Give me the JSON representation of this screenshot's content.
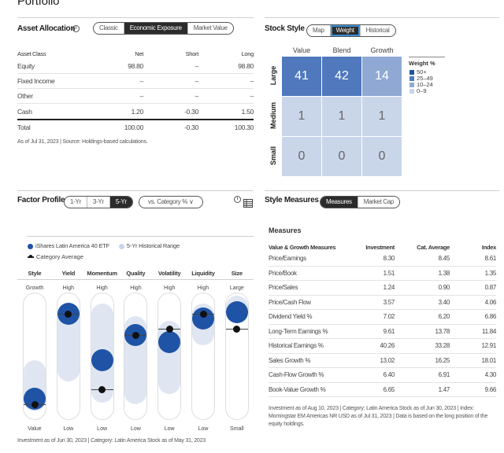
{
  "page_title": "Portfolio",
  "asset_allocation": {
    "title": "Asset Allocation",
    "tabs": [
      {
        "label": "Classic",
        "active": false
      },
      {
        "label": "Economic Exposure",
        "active": true
      },
      {
        "label": "Market Value",
        "active": false
      }
    ],
    "columns": [
      "Asset Class",
      "Net",
      "Short",
      "Long"
    ],
    "rows": [
      {
        "name": "Equity",
        "net": "98.80",
        "short": "–",
        "long": "98.80"
      },
      {
        "name": "Fixed Income",
        "net": "–",
        "short": "–",
        "long": "–"
      },
      {
        "name": "Other",
        "net": "–",
        "short": "–",
        "long": "–"
      },
      {
        "name": "Cash",
        "net": "1.20",
        "short": "-0.30",
        "long": "1.50"
      }
    ],
    "total": {
      "name": "Total",
      "net": "100.00",
      "short": "-0.30",
      "long": "100.30"
    },
    "note": "As of Jul 31, 2023 | Source: Holdings-based calculations."
  },
  "stock_style": {
    "title": "Stock Style",
    "tabs": [
      {
        "label": "Map",
        "active": false
      },
      {
        "label": "Weight",
        "active": true
      },
      {
        "label": "Historical",
        "active": false
      }
    ],
    "columns": [
      "Value",
      "Blend",
      "Growth"
    ],
    "rows": [
      "Large",
      "Medium",
      "Small"
    ],
    "values": [
      [
        "41",
        "42",
        "14"
      ],
      [
        "1",
        "1",
        "1"
      ],
      [
        "0",
        "0",
        "0"
      ]
    ],
    "legend_title": "Weight %",
    "legend": [
      {
        "label": "50+",
        "color": "#1f53a5"
      },
      {
        "label": "25–49",
        "color": "#4f78bd"
      },
      {
        "label": "10–24",
        "color": "#8fa9d4"
      },
      {
        "label": "0–9",
        "color": "#c9d6ea"
      }
    ]
  },
  "factor_profile": {
    "title": "Factor Profile",
    "period_tabs": [
      {
        "label": "1-Yr",
        "active": false
      },
      {
        "label": "3-Yr",
        "active": false
      },
      {
        "label": "5-Yr",
        "active": true
      }
    ],
    "compare_select": "vs. Category % ∨",
    "legend": {
      "fund": "iShares Latin America 40 ETF",
      "range": "5-Yr Historical Range",
      "category": "Category Average"
    },
    "factors": [
      {
        "name": "Style",
        "top": "Growth",
        "bottom": "Value",
        "fund": 0.16,
        "category": 0.12,
        "range": [
          0.06,
          0.47
        ]
      },
      {
        "name": "Yield",
        "top": "High",
        "bottom": "Low",
        "fund": 0.84,
        "category": 0.84,
        "range": [
          0.3,
          0.91
        ]
      },
      {
        "name": "Momentum",
        "top": "High",
        "bottom": "Low",
        "fund": 0.47,
        "category": 0.24,
        "range": [
          0.13,
          0.92
        ]
      },
      {
        "name": "Quality",
        "top": "High",
        "bottom": "Low",
        "fund": 0.67,
        "category": 0.67,
        "range": [
          0.12,
          0.82
        ]
      },
      {
        "name": "Volatility",
        "top": "High",
        "bottom": "Low",
        "fund": 0.61,
        "category": 0.72,
        "range": [
          0.2,
          0.78
        ]
      },
      {
        "name": "Liquidity",
        "top": "High",
        "bottom": "Low",
        "fund": 0.8,
        "category": 0.84,
        "range": [
          0.59,
          0.92
        ]
      },
      {
        "name": "Size",
        "top": "Large",
        "bottom": "Small",
        "fund": 0.85,
        "category": 0.72,
        "range": [
          0.76,
          0.98
        ]
      }
    ],
    "note": "Investment as of Jun 30, 2023 | Category: Latin America Stock as of May 31, 2023"
  },
  "style_measures": {
    "title": "Style Measures",
    "tabs": [
      {
        "label": "Measures",
        "active": true
      },
      {
        "label": "Market Cap",
        "active": false
      }
    ],
    "subtitle": "Measures",
    "columns": [
      "Value & Growth Measures",
      "Investment",
      "Cat. Average",
      "Index"
    ],
    "rows": [
      {
        "name": "Price/Earnings",
        "investment": "8.30",
        "cat": "8.45",
        "index": "8.61"
      },
      {
        "name": "Price/Book",
        "investment": "1.51",
        "cat": "1.38",
        "index": "1.35"
      },
      {
        "name": "Price/Sales",
        "investment": "1.24",
        "cat": "0.90",
        "index": "0.87"
      },
      {
        "name": "Price/Cash Flow",
        "investment": "3.57",
        "cat": "3.40",
        "index": "4.06"
      },
      {
        "name": "Dividend Yield %",
        "investment": "7.02",
        "cat": "6.20",
        "index": "6.86"
      },
      {
        "name": "Long-Term Earnings %",
        "investment": "9.61",
        "cat": "13.78",
        "index": "11.84"
      },
      {
        "name": "Historical Earnings %",
        "investment": "40.26",
        "cat": "33.28",
        "index": "12.91"
      },
      {
        "name": "Sales Growth %",
        "investment": "13.02",
        "cat": "16.25",
        "index": "18.01"
      },
      {
        "name": "Cash-Flow Growth %",
        "investment": "6.40",
        "cat": "6.91",
        "index": "4.30"
      },
      {
        "name": "Book-Value Growth %",
        "investment": "6.65",
        "cat": "1.47",
        "index": "9.66"
      }
    ],
    "note": "Investment as of Aug 10, 2023 | Category: Latin America Stock as of Jun 30, 2023 | Index: Morningstar EM Americas NR USD as of Jul 31, 2023 | Data is based on the long position of the equity holdings."
  }
}
